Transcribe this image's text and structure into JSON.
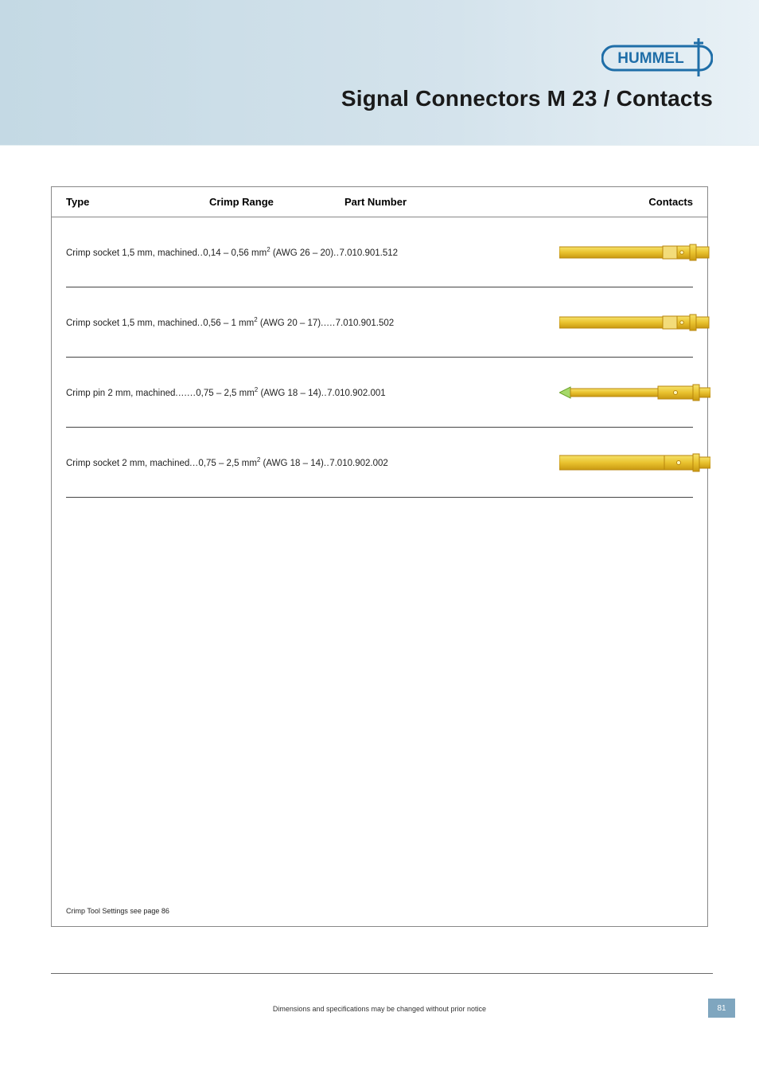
{
  "brand": "HUMMEL",
  "pageTitle": "Signal Connectors M 23 / Contacts",
  "tableHeaders": {
    "type": "Type",
    "crimpRange": "Crimp Range",
    "partNumber": "Part Number",
    "contacts": "Contacts"
  },
  "rows": [
    {
      "type": "Crimp socket 1,5 mm, machined",
      "dots1": "..",
      "range": "0,14 – 0,56 mm",
      "sup": "2",
      "awg": " (AWG 26 – 20)",
      "dots2": "..",
      "partNumber": "7.010.901.512",
      "imgKind": "socket15"
    },
    {
      "type": "Crimp socket 1,5 mm, machined",
      "dots1": "..",
      "range": "0,56 – 1 mm",
      "sup": "2",
      "awg": " (AWG 20 – 17)",
      "dots2": " .....",
      "partNumber": "7.010.901.502",
      "imgKind": "socket15"
    },
    {
      "type": "Crimp pin 2 mm, machined ",
      "dots1": ".......",
      "range": "0,75 – 2,5 mm",
      "sup": "2",
      "awg": " (AWG 18 – 14)",
      "dots2": " ..",
      "partNumber": "7.010.902.001",
      "imgKind": "pin2"
    },
    {
      "type": "Crimp socket 2 mm, machined ",
      "dots1": "...",
      "range": "0,75 – 2,5 mm",
      "sup": "2",
      "awg": " (AWG 18 – 14)",
      "dots2": "..",
      "partNumber": "7.010.902.002",
      "imgKind": "socket2"
    }
  ],
  "footnote": "Crimp Tool Settings see page 86",
  "footerText": "Dimensions and specifications may be changed without prior notice",
  "pageNumber": "81"
}
